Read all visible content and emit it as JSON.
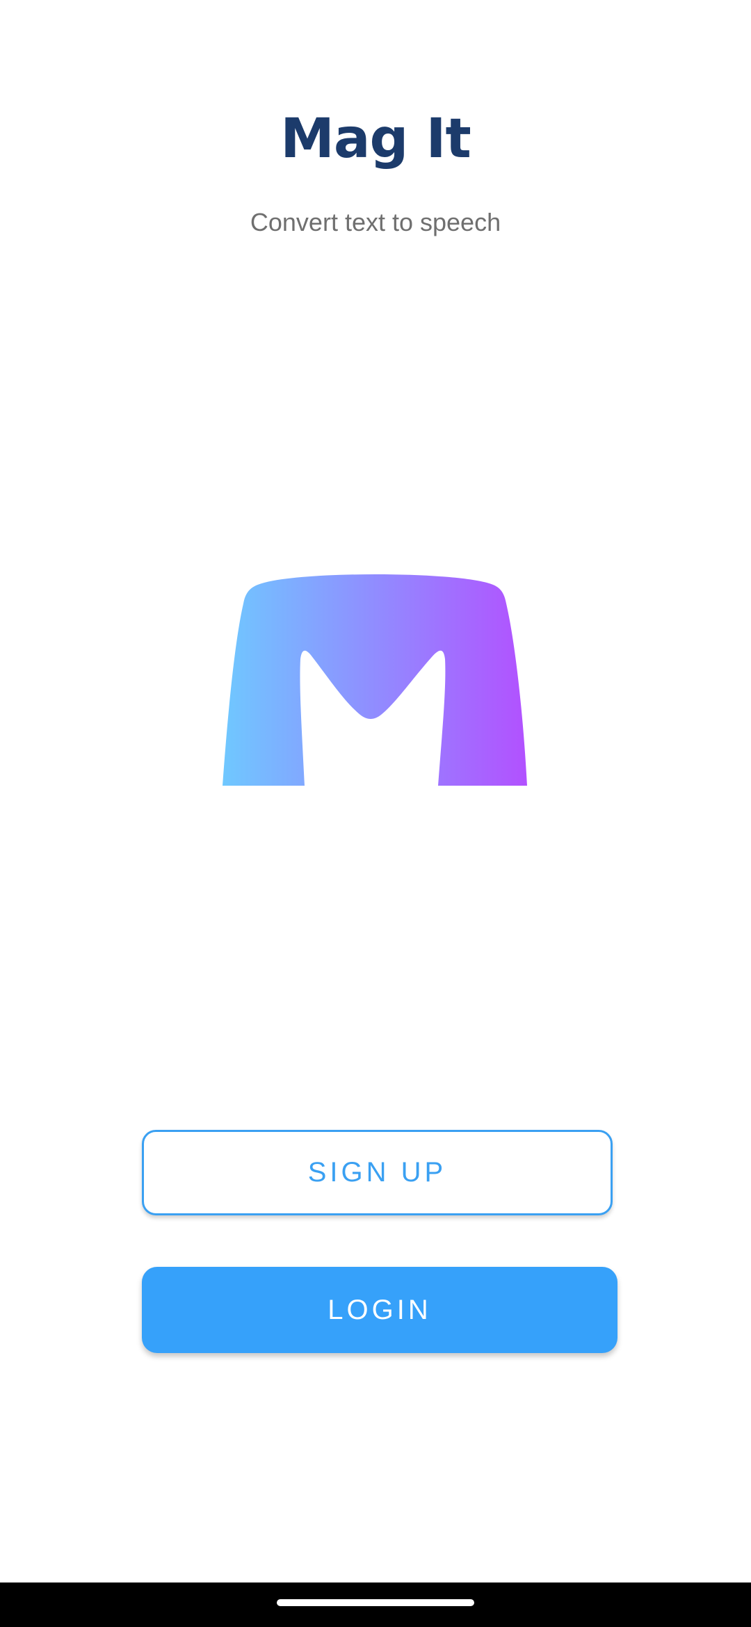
{
  "app": {
    "title": "Mag It",
    "subtitle": "Convert text to speech"
  },
  "logo": {
    "name": "mag-it-logo",
    "gradient_start": "#6fc8ff",
    "gradient_end": "#b251ff"
  },
  "actions": {
    "signup_label": "SIGN UP",
    "login_label": "LOGIN"
  },
  "colors": {
    "title": "#1c3b6b",
    "accent": "#36a1fa",
    "subtitle": "#6f6f6f"
  }
}
